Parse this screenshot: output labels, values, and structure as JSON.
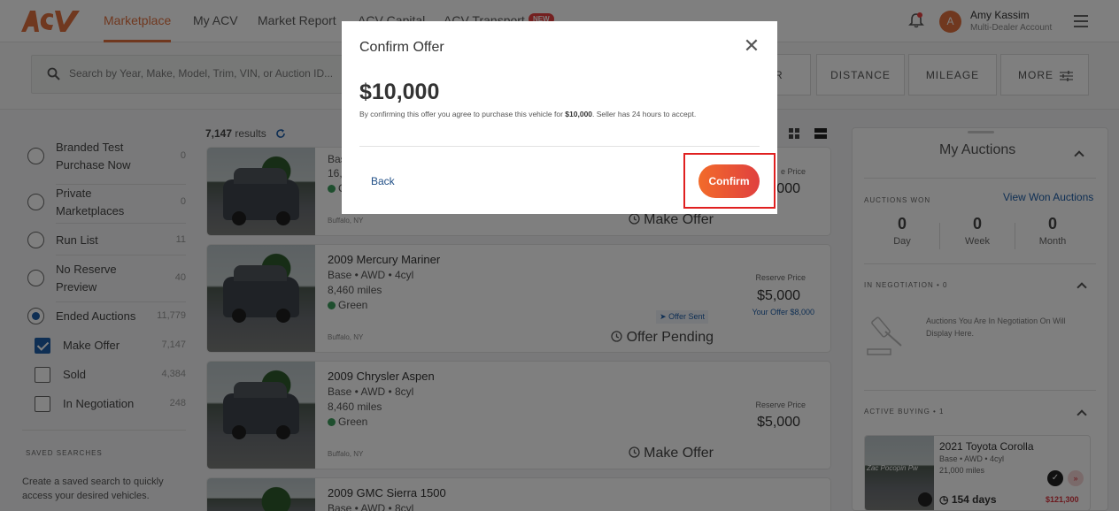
{
  "header": {
    "logo_text": "ACV AUCTIONS",
    "nav": [
      "Marketplace",
      "My ACV",
      "Market Report",
      "ACV Capital",
      "ACV Transport"
    ],
    "new_badge": "NEW",
    "user_initial": "A",
    "user_name": "Amy Kassim",
    "user_sub": "Multi-Dealer Account"
  },
  "search": {
    "placeholder": "Search by Year, Make, Model, Trim, VIN, or Auction ID...",
    "filters": [
      "R",
      "DISTANCE",
      "MILEAGE",
      "MORE"
    ]
  },
  "filters": {
    "items": [
      {
        "label": "Branded Test Purchase Now",
        "count": "0"
      },
      {
        "label": "Private Marketplaces",
        "count": "0"
      },
      {
        "label": "Run List",
        "count": "11"
      },
      {
        "label": "No Reserve Preview",
        "count": "40"
      },
      {
        "label": "Ended Auctions",
        "count": "11,779"
      }
    ],
    "sub": [
      {
        "label": "Make Offer",
        "count": "7,147"
      },
      {
        "label": "Sold",
        "count": "4,384"
      },
      {
        "label": "In Negotiation",
        "count": "248"
      }
    ],
    "saved_heading": "SAVED SEARCHES",
    "saved_text": "Create a saved search to quickly access your desired vehicles."
  },
  "results": {
    "count": "7,147",
    "label": "results"
  },
  "cards": [
    {
      "title": "",
      "details": "Bas",
      "miles": "16,",
      "color": "G",
      "location": "Buffalo, NY",
      "reserve_label": "e Price",
      "reserve": "000",
      "status": "Make Offer"
    },
    {
      "title": "2009 Mercury Mariner",
      "details": "Base • AWD • 4cyl",
      "miles": "8,460 miles",
      "color": "Green",
      "location": "Buffalo, NY",
      "reserve_label": "Reserve Price",
      "reserve": "$5,000",
      "your_offer": "Your Offer $8,000",
      "sent": "Offer Sent",
      "status": "Offer Pending"
    },
    {
      "title": "2009 Chrysler Aspen",
      "details": "Base • AWD • 8cyl",
      "miles": "8,460 miles",
      "color": "Green",
      "location": "Buffalo, NY",
      "reserve_label": "Reserve Price",
      "reserve": "$5,000",
      "status": "Make Offer"
    },
    {
      "title": "2009 GMC Sierra 1500",
      "details": "Base • AWD • 8cyl"
    }
  ],
  "my_auctions": {
    "title": "My Auctions",
    "won_heading": "AUCTIONS WON",
    "won_link": "View Won Auctions",
    "stats": [
      {
        "value": "0",
        "label": "Day"
      },
      {
        "value": "0",
        "label": "Week"
      },
      {
        "value": "0",
        "label": "Month"
      }
    ],
    "negotiation_heading": "IN NEGOTIATION • 0",
    "negotiation_text": "Auctions You Are In Negotiation On Will Display Here.",
    "active_heading": "ACTIVE BUYING • 1",
    "active": {
      "title": "2021 Toyota Corolla",
      "details": "Base • AWD • 4cyl",
      "miles": "21,000 miles",
      "days": "154 days",
      "price": "$121,300",
      "watermark": "Zac Pocopin Pw"
    }
  },
  "modal": {
    "title": "Confirm Offer",
    "amount": "$10,000",
    "desc_pre": "By confirming this offer you agree to purchase this vehicle for ",
    "desc_amount": "$10,000",
    "desc_post": ". Seller has 24 hours to accept.",
    "back": "Back",
    "confirm": "Confirm"
  },
  "colors": {
    "brand": "#e0703f",
    "link": "#1f5fa8",
    "confirm": "#e8553a",
    "highlight": "#e02020"
  }
}
